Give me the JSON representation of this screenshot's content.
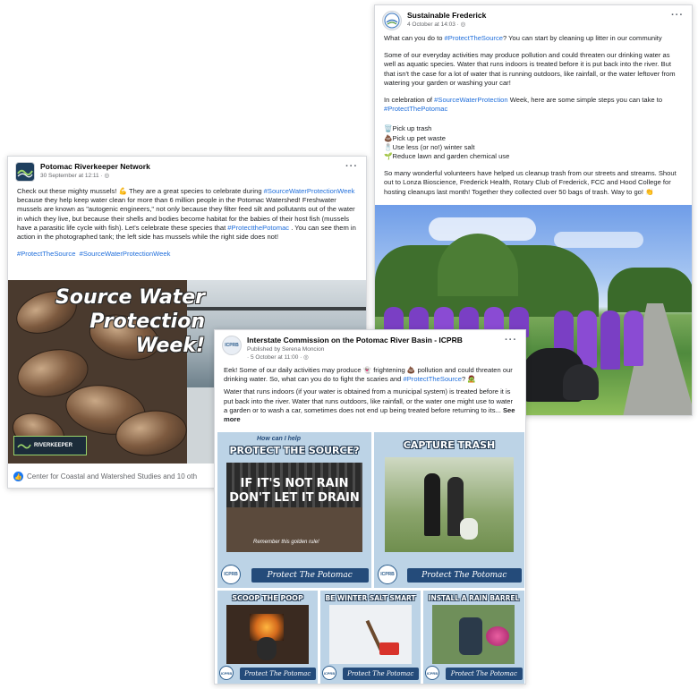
{
  "posts": [
    {
      "page_name": "Sustainable Frederick",
      "date": "4 October at 14:03 · ",
      "more": "···",
      "paragraphs": [
        {
          "pre": "What can you do to ",
          "tag": "#ProtectTheSource",
          "post": "? You can start by cleaning up litter in our community"
        },
        {
          "text": "Some of our everyday activities may produce pollution and could threaten our drinking water as well as aquatic species. Water that runs indoors is treated before it is put back into the river. But that isn't the case for a lot of water that is running outdoors, like rainfall, or the water leftover from watering your garden or washing your car!"
        },
        {
          "pre": "In celebration of ",
          "tag": "#SourceWaterProtection",
          "post": " Week, here are some simple steps you can take to",
          "tag2": "#ProtectThePotomac"
        }
      ],
      "steps": [
        "🗑️Pick up trash",
        "💩Pick up pet waste",
        "🧂Use less (or no!) winter salt",
        "🌱Reduce lawn and garden chemical use"
      ],
      "closing": "So many wonderful volunteers have helped us cleanup trash from our streets and streams. Shout out to Lonza Bioscience, Frederick Health, Rotary Club of Frederick, FCC and Hood College for hosting cleanups last month! Together they collected over 50 bags of trash. Way to go! 👏"
    },
    {
      "page_name": "Potomac Riverkeeper Network",
      "date": "30 September at 12:11 · ",
      "more": "···",
      "text_a": "Check out these mighty mussels! 💪 They are a great species to celebrate during ",
      "tag_a": "#SourceWaterProtectionWeek",
      "text_b": " because they help keep water clean for more than 6 million people in the Potomac Watershed! Freshwater mussels are known as \"autogenic engineers,\" not only because they filter feed silt and pollutants out of the water in which they live, but because their shells and bodies become habitat for the babies of their host fish (mussels have a parasitic life cycle with fish). Let's celebrate these species that ",
      "tag_b": "#ProtectthePotomac",
      "text_c": " . You can see them in action in the photographed tank; the left side has mussels while the right side does not!",
      "hashtags": [
        "#ProtectTheSource",
        "#SourceWaterProtectionWeek"
      ],
      "hero_lines": [
        "Source Water",
        "Protection",
        "Week!"
      ],
      "logo_text": "RIVERKEEPER",
      "reactions": "Center for Coastal and Watershed Studies and 10 oth"
    },
    {
      "page_name": "Interstate Commission on the Potomac River Basin - ICPRB",
      "published_by": "Published by Serena Moncion",
      "date": "· 5 October at 11:00 · ",
      "more": "···",
      "text_a": "Eek! Some of our daily activities may produce 👻 frightening 💩 pollution and could threaten our drinking water. So, what can you do to fight the scaries and ",
      "tag_a": "#ProtectTheSource",
      "text_b": "? 🧟",
      "text_c": "Water that runs indoors (if your water is obtained from a municipal system) is treated before it is put back into the river. Water that runs outdoors, like rainfall, or the water one might use to water a garden or to wash a car, sometimes does not end up being treated before returning to its... ",
      "see_more": "See more",
      "panels": {
        "how_can_i_help": "How can I help",
        "protect_source": "PROTECT THE SOURCE?",
        "rain_line1": "IF IT'S NOT RAIN",
        "rain_line2": "DON'T LET IT DRAIN",
        "golden_rule": "Remember this golden rule!",
        "capture_trash": "CAPTURE TRASH",
        "scoop_poop": "SCOOP THE POOP",
        "winter_salt": "BE WINTER SALT SMART",
        "rain_barrel": "INSTALL A RAIN BARREL",
        "protect_potomac": "Protect The Potomac",
        "badge": "ICPRB"
      }
    }
  ]
}
